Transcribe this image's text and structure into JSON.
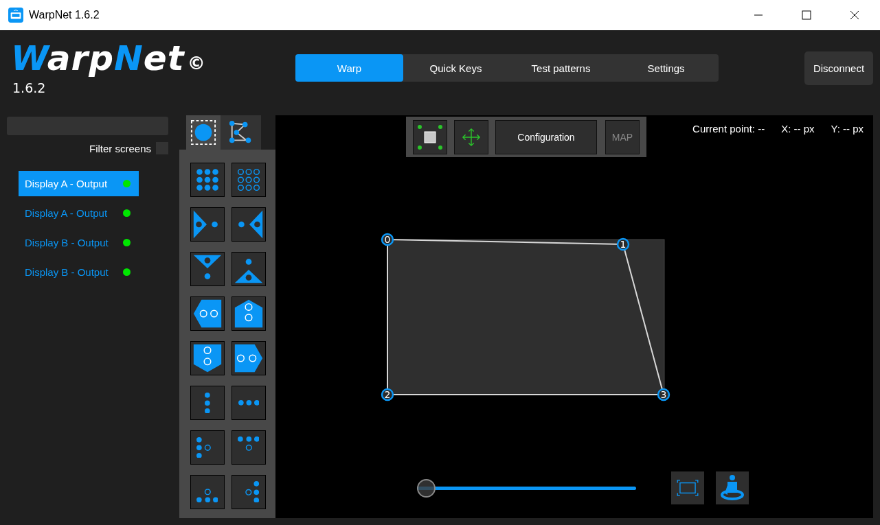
{
  "window": {
    "title": "WarpNet 1.6.2"
  },
  "logo": {
    "parts": [
      {
        "text": "W",
        "accent": true
      },
      {
        "text": "arp",
        "accent": false
      },
      {
        "text": "N",
        "accent": true
      },
      {
        "text": "et",
        "accent": false
      }
    ],
    "mark": "©",
    "version": "1.6.2"
  },
  "tabs": [
    {
      "label": "Warp",
      "selected": true
    },
    {
      "label": "Quick Keys",
      "selected": false
    },
    {
      "label": "Test patterns",
      "selected": false
    },
    {
      "label": "Settings",
      "selected": false
    }
  ],
  "disconnect": "Disconnect",
  "sidebar": {
    "filter_label": "Filter screens",
    "filter_checked": false,
    "items": [
      {
        "label": "Display A - Output",
        "selected": true,
        "color": "#00e600"
      },
      {
        "label": "Display A - Output",
        "selected": false,
        "color": "#00e600"
      },
      {
        "label": "Display B - Output",
        "selected": false,
        "color": "#00e600"
      },
      {
        "label": "Display B - Output",
        "selected": false,
        "color": "#00e600"
      }
    ]
  },
  "tool_tabs": [
    {
      "kind": "point",
      "selected": true
    },
    {
      "kind": "mesh",
      "selected": false
    }
  ],
  "patterns": [
    {
      "kind": "grid-filled"
    },
    {
      "kind": "grid-outline"
    },
    {
      "kind": "tri-right"
    },
    {
      "kind": "tri-left"
    },
    {
      "kind": "tri-down"
    },
    {
      "kind": "tri-up"
    },
    {
      "kind": "pent-left"
    },
    {
      "kind": "pent-up"
    },
    {
      "kind": "pent-down"
    },
    {
      "kind": "pent-right"
    },
    {
      "kind": "col3"
    },
    {
      "kind": "row3"
    },
    {
      "kind": "tee-left"
    },
    {
      "kind": "tee-top"
    },
    {
      "kind": "tee-bottom"
    },
    {
      "kind": "tee-right"
    }
  ],
  "toolbar": {
    "configuration": "Configuration",
    "map": "MAP",
    "map_disabled": true
  },
  "info": {
    "current_point": "Current point: --",
    "x": "X: -- px",
    "y": "Y: -- px"
  },
  "points": [
    {
      "label": "0"
    },
    {
      "label": "1"
    },
    {
      "label": "2"
    },
    {
      "label": "3"
    }
  ],
  "zoom_slider": {
    "level": 0
  }
}
